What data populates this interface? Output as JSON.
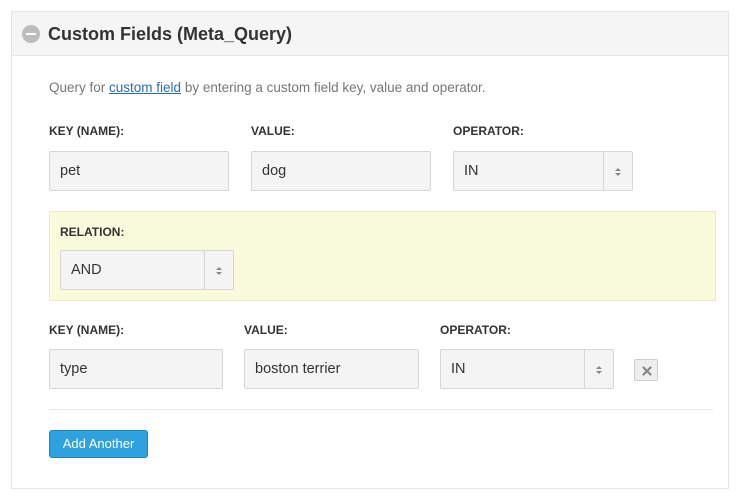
{
  "panel": {
    "title": "Custom Fields (Meta_Query)",
    "intro_prefix": "Query for ",
    "intro_link": "custom field",
    "intro_suffix": " by entering a custom field key, value and operator."
  },
  "labels": {
    "key": "KEY (NAME):",
    "value": "VALUE:",
    "operator": "OPERATOR:",
    "relation": "RELATION:"
  },
  "rows": [
    {
      "key": "pet",
      "value": "dog",
      "operator": "IN"
    },
    {
      "key": "type",
      "value": "boston terrier",
      "operator": "IN"
    }
  ],
  "relation": {
    "value": "AND"
  },
  "actions": {
    "add_label": "Add Another"
  },
  "icons": {
    "collapse": "minus-circle-icon",
    "select_arrows": "sort-arrows-icon",
    "remove": "close-icon"
  }
}
